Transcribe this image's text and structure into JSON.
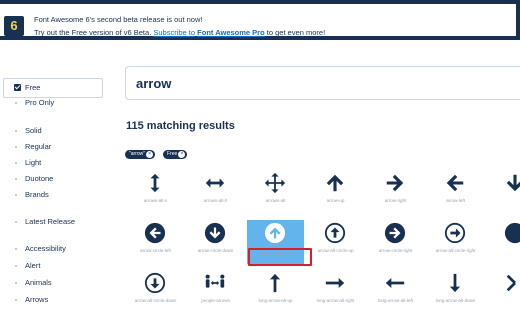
{
  "banner": {
    "logo_text": "6",
    "line1": "Font Awesome 6's second beta release is out now!",
    "line2_pre": "Try out the Free version of v6 Beta.",
    "line2_link": "Subscribe to",
    "line2_bold": "Font Awesome Pro",
    "line2_post": "to get even more!"
  },
  "sidebar": {
    "free_label": "Free",
    "items": [
      "Pro Only",
      "Solid",
      "Regular",
      "Light",
      "Duotone",
      "Brands",
      "Latest Release",
      "Accessibility",
      "Alert",
      "Animals",
      "Arrows"
    ]
  },
  "search": {
    "value": "arrow"
  },
  "results_text": "115 matching results",
  "filters": [
    "\"arrow\"",
    "Free"
  ],
  "icons": [
    {
      "name": "arrows-alt-v",
      "icon": "arrows-v-icon"
    },
    {
      "name": "arrows-alt-h",
      "icon": "arrows-h-icon"
    },
    {
      "name": "arrows-alt",
      "icon": "arrows-all-icon"
    },
    {
      "name": "arrow-up",
      "icon": "arrow-up-icon"
    },
    {
      "name": "arrow-right",
      "icon": "arrow-right-icon"
    },
    {
      "name": "arrow-left",
      "icon": "arrow-left-icon"
    },
    {
      "name": "arrow-circle-left",
      "icon": "circle-left-icon"
    },
    {
      "name": "arrow-circle-down",
      "icon": "circle-down-icon"
    },
    {
      "name": "arrow-circle-up",
      "icon": "circle-up-icon"
    },
    {
      "name": "arrow-alt-circle-up",
      "icon": "alt-circle-up-icon"
    },
    {
      "name": "arrow-circle-right",
      "icon": "circle-right-icon"
    },
    {
      "name": "arrow-alt-circle-right",
      "icon": "alt-circle-right-icon"
    },
    {
      "name": "arrow-alt-circle-down",
      "icon": "alt-circle-down-icon"
    },
    {
      "name": "people-arrows",
      "icon": "people-arrows-icon"
    },
    {
      "name": "long-arrow-alt-up",
      "icon": "long-arrow-up-icon"
    },
    {
      "name": "long-arrow-alt-right",
      "icon": "long-arrow-right-icon"
    },
    {
      "name": "long-arrow-alt-left",
      "icon": "long-arrow-left-icon"
    },
    {
      "name": "long-arrow-alt-down",
      "icon": "long-arrow-down-icon"
    }
  ],
  "selected_icon": "arrow-circle-up",
  "colors": {
    "navy": "#183153",
    "selected": "#63b3ed",
    "highlight": "#d61f26"
  }
}
